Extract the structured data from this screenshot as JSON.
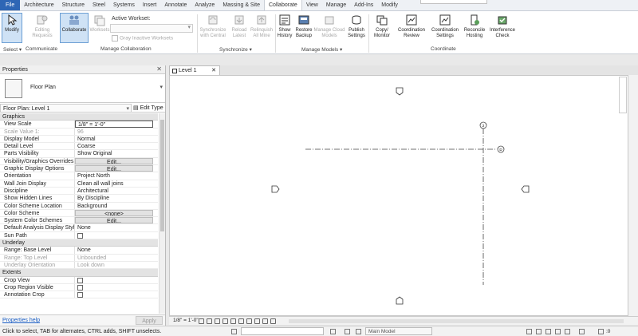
{
  "ribbon": {
    "tabs": [
      {
        "label": "File",
        "kind": "file"
      },
      {
        "label": "Architecture"
      },
      {
        "label": "Structure"
      },
      {
        "label": "Steel"
      },
      {
        "label": "Systems"
      },
      {
        "label": "Insert"
      },
      {
        "label": "Annotate"
      },
      {
        "label": "Analyze"
      },
      {
        "label": "Massing & Site"
      },
      {
        "label": "Collaborate",
        "active": true
      },
      {
        "label": "View"
      },
      {
        "label": "Manage"
      },
      {
        "label": "Add-Ins"
      },
      {
        "label": "Modify"
      }
    ],
    "buttons": {
      "modify": "Modify",
      "editing_requests": "Editing Requests",
      "collaborate": "Collaborate",
      "worksets": "Worksets",
      "active_workset_label": "Active Workset:",
      "gray_inactive": "Gray Inactive Worksets",
      "sync_central": "Synchronize with Central",
      "reload_latest": "Reload Latest",
      "relinquish_all": "Relinquish All Mine",
      "show_history": "Show History",
      "restore_backup": "Restore Backup",
      "manage_cloud": "Manage Cloud Models",
      "publish_settings": "Publish Settings",
      "copy_monitor": "Copy/ Monitor",
      "coordination_review": "Coordination Review",
      "coordination_settings": "Coordination Settings",
      "reconcile_hosting": "Reconcile Hosting",
      "interference_check": "Interference Check"
    },
    "panels": {
      "select": "Select ▾",
      "communicate": "Communicate",
      "manage_collab": "Manage Collaboration",
      "synchronize": "Synchronize ▾",
      "manage_models": "Manage Models ▾",
      "coordinate": "Coordinate"
    }
  },
  "properties": {
    "title": "Properties",
    "type_name": "Floor Plan",
    "instance": "Floor Plan: Level 1",
    "edit_type": "Edit Type",
    "help": "Properties help",
    "apply": "Apply",
    "groups": [
      {
        "category": "Graphics",
        "rows": [
          {
            "name": "View Scale",
            "value": "1/8\" = 1'-0\"",
            "style": "boxed"
          },
          {
            "name": "Scale Value    1:",
            "value": "96",
            "dim": true
          },
          {
            "name": "Display Model",
            "value": "Normal"
          },
          {
            "name": "Detail Level",
            "value": "Coarse"
          },
          {
            "name": "Parts Visibility",
            "value": "Show Original"
          },
          {
            "name": "Visibility/Graphics Overrides",
            "value": "Edit...",
            "style": "btn"
          },
          {
            "name": "Graphic Display Options",
            "value": "Edit...",
            "style": "btn"
          },
          {
            "name": "Orientation",
            "value": "Project North"
          },
          {
            "name": "Wall Join Display",
            "value": "Clean all wall joins"
          },
          {
            "name": "Discipline",
            "value": "Architectural"
          },
          {
            "name": "Show Hidden Lines",
            "value": "By Discipline"
          },
          {
            "name": "Color Scheme Location",
            "value": "Background"
          },
          {
            "name": "Color Scheme",
            "value": "<none>",
            "style": "btn"
          },
          {
            "name": "System Color Schemes",
            "value": "Edit...",
            "style": "btn"
          },
          {
            "name": "Default Analysis Display Style",
            "value": "None"
          },
          {
            "name": "Sun Path",
            "value": "",
            "checkbox": true
          }
        ]
      },
      {
        "category": "Underlay",
        "rows": [
          {
            "name": "Range: Base Level",
            "value": "None"
          },
          {
            "name": "Range: Top Level",
            "value": "Unbounded",
            "dim": true
          },
          {
            "name": "Underlay Orientation",
            "value": "Look down",
            "dim": true
          }
        ]
      },
      {
        "category": "Extents",
        "rows": [
          {
            "name": "Crop View",
            "value": "",
            "checkbox": true
          },
          {
            "name": "Crop Region Visible",
            "value": "",
            "checkbox": true
          },
          {
            "name": "Annotation Crop",
            "value": "",
            "checkbox": true
          }
        ]
      }
    ]
  },
  "view": {
    "tab_label": "Level 1",
    "scale": "1/8\" = 1'-0\"",
    "grid_bubble_labels": [
      "2",
      "D"
    ]
  },
  "statusbar": {
    "message": "Click to select, TAB for alternates, CTRL adds, SHIFT unselects.",
    "model": "Main Model",
    "active_filter": ":0"
  }
}
